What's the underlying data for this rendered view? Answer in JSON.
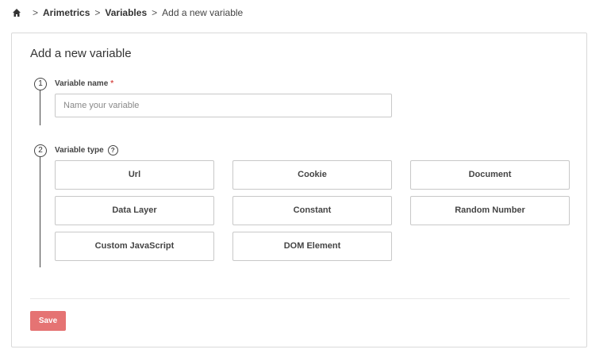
{
  "breadcrumb": {
    "home_icon": "home-icon",
    "separator": ">",
    "items": [
      "Arimetrics",
      "Variables"
    ],
    "current": "Add a new variable"
  },
  "form": {
    "title": "Add a new variable",
    "steps": [
      {
        "number": "1",
        "label": "Variable name",
        "required_marker": "*"
      },
      {
        "number": "2",
        "label": "Variable type",
        "help_icon": "question-circle-icon",
        "help_glyph": "?"
      }
    ],
    "name_placeholder": "Name your variable",
    "name_value": "",
    "variable_types": [
      "Url",
      "Cookie",
      "Document",
      "Data Layer",
      "Constant",
      "Random Number",
      "Custom JavaScript",
      "DOM Element"
    ],
    "save_label": "Save"
  },
  "colors": {
    "save_button": "#e57373",
    "required": "#d9534f",
    "border": "#c8c8c8"
  }
}
